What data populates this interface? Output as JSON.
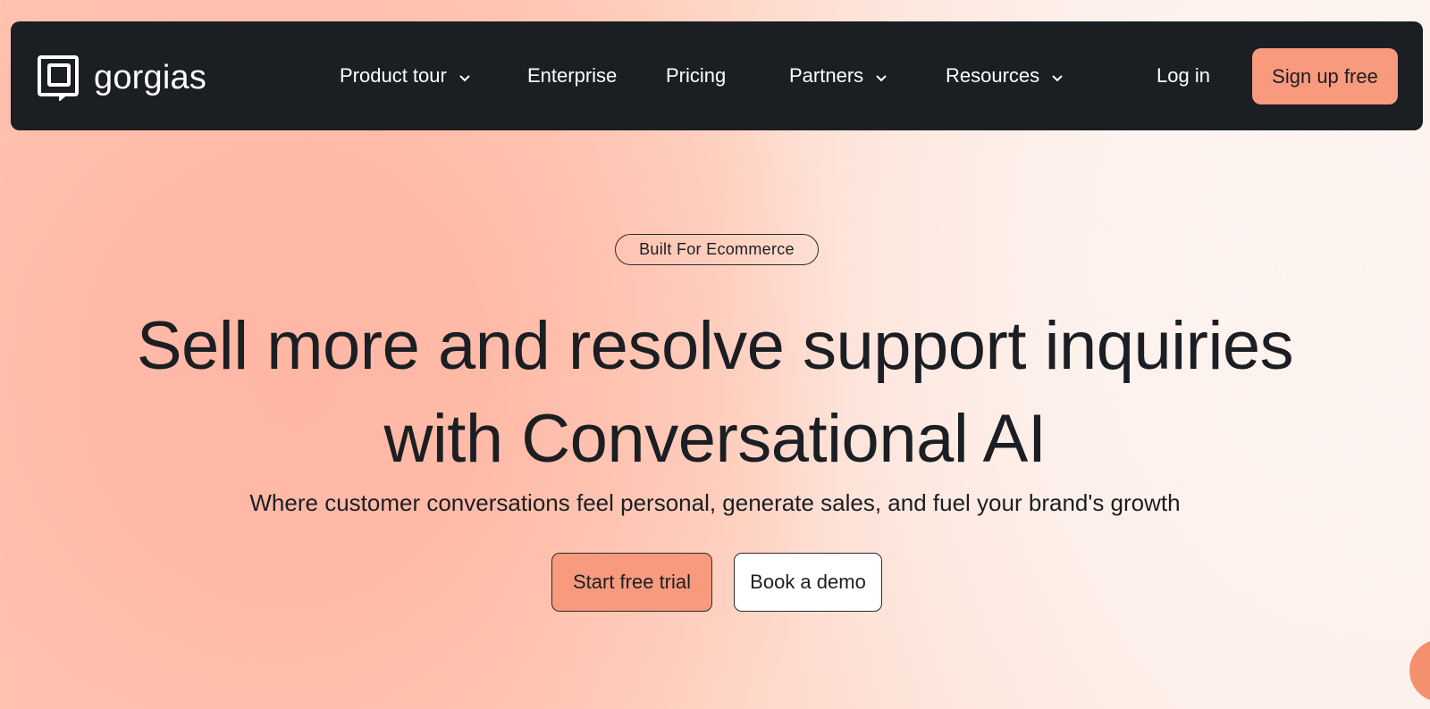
{
  "header": {
    "logo_text": "gorgias",
    "nav": [
      {
        "label": "Product tour",
        "has_dropdown": true
      },
      {
        "label": "Enterprise",
        "has_dropdown": false
      },
      {
        "label": "Pricing",
        "has_dropdown": false
      },
      {
        "label": "Partners",
        "has_dropdown": true
      },
      {
        "label": "Resources",
        "has_dropdown": true
      }
    ],
    "login_label": "Log in",
    "signup_label": "Sign up free"
  },
  "hero": {
    "badge": "Built For Ecommerce",
    "headline_line1": "Sell more and resolve support inquiries",
    "headline_line2": "with Conversational AI",
    "subheadline": "Where customer conversations feel personal, generate sales, and fuel your brand's growth",
    "primary_cta": "Start free trial",
    "secondary_cta": "Book a demo"
  },
  "icons": {
    "logo": "gorgias-logo-icon",
    "dropdown": "chevron-down-icon",
    "chat": "chat-launcher-icon"
  },
  "colors": {
    "nav_bg": "#1b1e23",
    "accent": "#f89a7e",
    "text_dark": "#1b1e23",
    "hero_gradient_left": "#ffb7a4",
    "hero_gradient_right": "#fcefe9"
  }
}
